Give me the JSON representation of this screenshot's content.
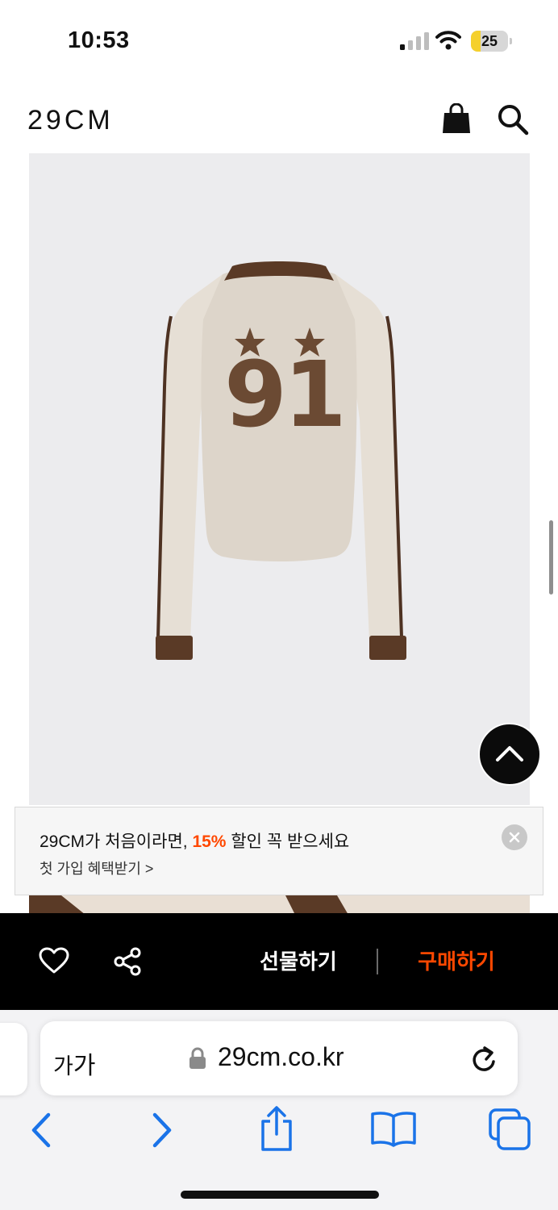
{
  "status_bar": {
    "time": "10:53",
    "battery_level": "25",
    "battery_fraction": 0.25,
    "battery_color": "#f5d02c"
  },
  "header": {
    "logo": "29CM",
    "icons": [
      "bag-icon",
      "search-icon"
    ]
  },
  "product": {
    "back_print_number": "91",
    "garment_color": "#ddd5ca",
    "trim_color": "#5a3a26"
  },
  "promo": {
    "text_before": "29CM가 처음이라면, ",
    "discount": "15%",
    "text_after": " 할인 꼭 받으세요",
    "sub_link": "첫 가입 혜택받기 >",
    "accent_color": "#ff4800"
  },
  "action_bar": {
    "gift_label": "선물하기",
    "buy_label": "구매하기",
    "icons": [
      "heart-icon",
      "share-icon"
    ]
  },
  "browser": {
    "text_size_small": "가",
    "text_size_large": "가",
    "url": "29cm.co.kr",
    "icons": [
      "lock-icon",
      "reload-icon",
      "back-icon",
      "forward-icon",
      "share-icon",
      "bookmarks-icon",
      "tabs-icon"
    ]
  }
}
